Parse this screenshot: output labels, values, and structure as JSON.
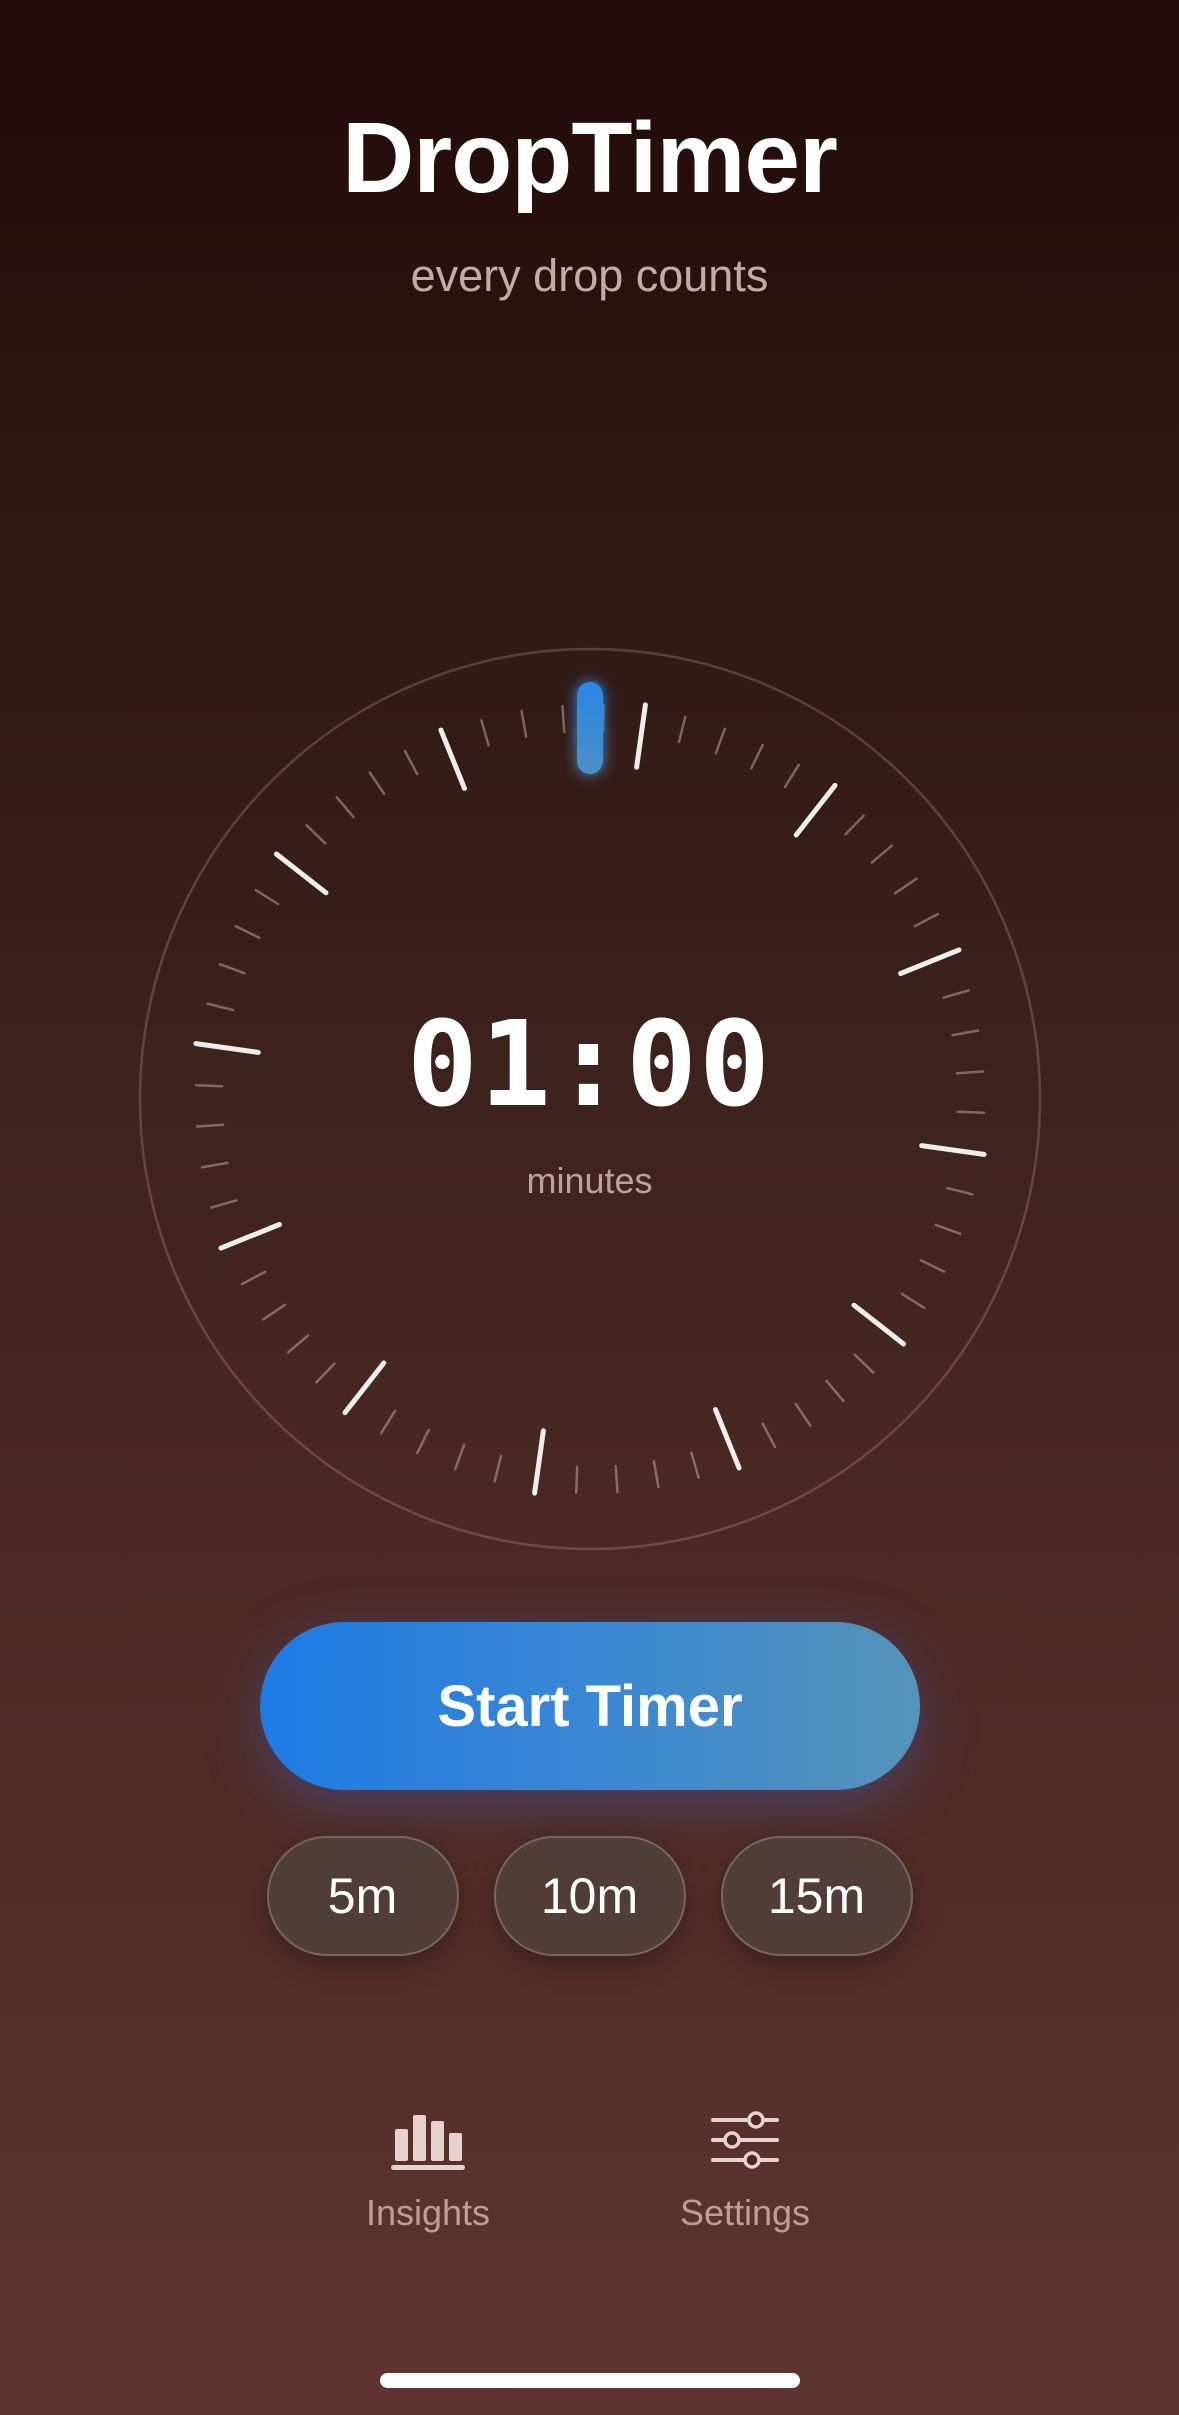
{
  "app": {
    "title": "DropTimer",
    "subtitle": "every drop counts"
  },
  "timer": {
    "display": "01:00",
    "unit": "minutes",
    "progress_fraction": 0
  },
  "actions": {
    "start_label": "Start Timer"
  },
  "presets": [
    {
      "label": "5m"
    },
    {
      "label": "10m"
    },
    {
      "label": "15m"
    }
  ],
  "tab_bar": {
    "items": [
      {
        "label": "Insights",
        "icon": "bar-chart-icon"
      },
      {
        "label": "Settings",
        "icon": "sliders-icon"
      }
    ]
  },
  "colors": {
    "accent": "#1e7be3",
    "accent_end": "#5594b8",
    "background_top": "#230a0b",
    "background_bottom": "#5f3530"
  }
}
